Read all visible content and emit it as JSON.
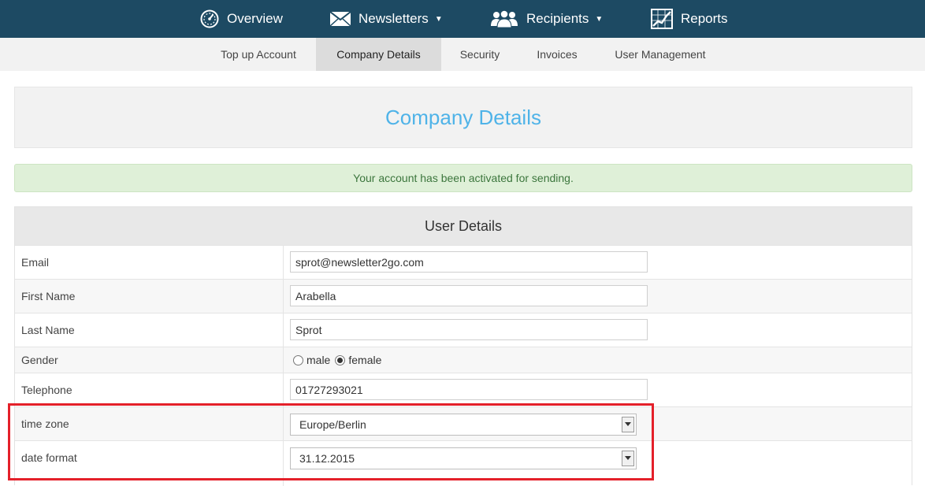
{
  "nav": {
    "overview": "Overview",
    "newsletters": "Newsletters",
    "recipients": "Recipients",
    "reports": "Reports",
    "caret": "▼"
  },
  "subnav": {
    "items": [
      "Top up Account",
      "Company Details",
      "Security",
      "Invoices",
      "User Management"
    ],
    "active": "Company Details"
  },
  "page_title": "Company Details",
  "alert": "Your account has been activated for sending.",
  "panel": {
    "title": "User Details",
    "fields": {
      "email": {
        "label": "Email",
        "value": "sprot@newsletter2go.com"
      },
      "first_name": {
        "label": "First Name",
        "value": "Arabella"
      },
      "last_name": {
        "label": "Last Name",
        "value": "Sprot"
      },
      "gender": {
        "label": "Gender",
        "options": [
          "male",
          "female"
        ],
        "selected": "female"
      },
      "telephone": {
        "label": "Telephone",
        "value": "01727293021"
      },
      "time_zone": {
        "label": "time zone",
        "value": "Europe/Berlin"
      },
      "date_format": {
        "label": "date format",
        "value": "31.12.2015"
      }
    }
  },
  "colors": {
    "nav_bg": "#1d4a63",
    "title_blue": "#4fb3e8",
    "alert_bg": "#dff0d8",
    "highlight_red": "#e4202a"
  }
}
